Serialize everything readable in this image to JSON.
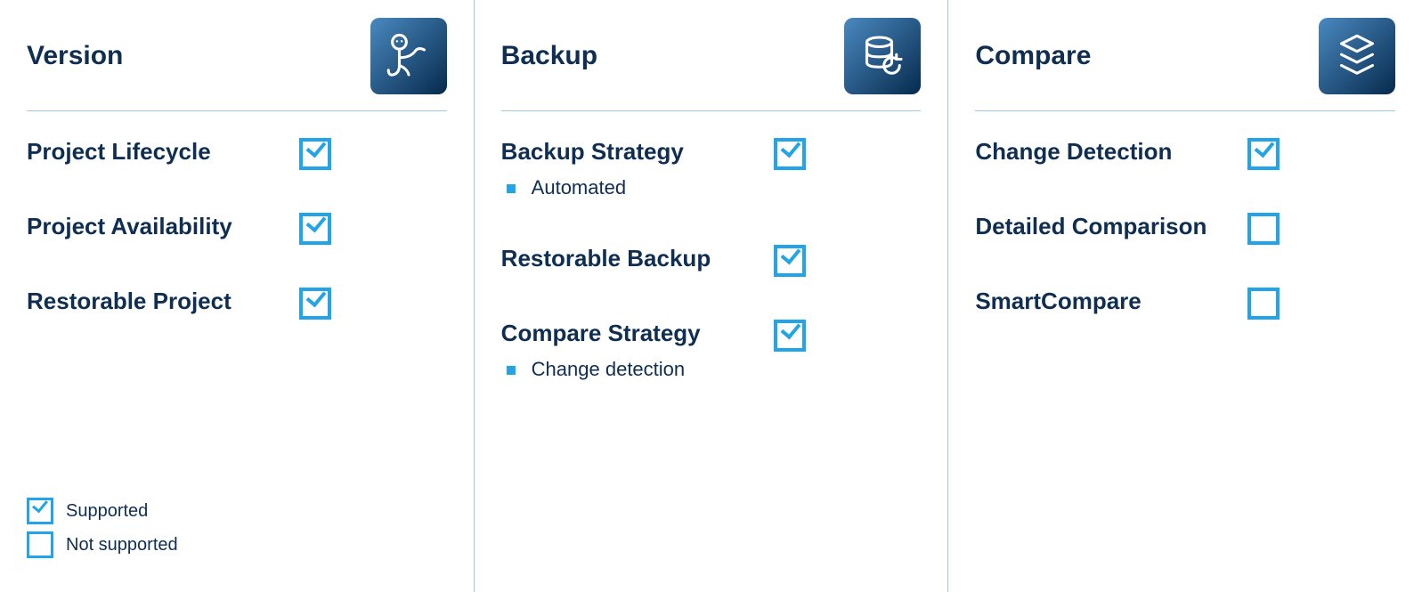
{
  "colors": {
    "heading": "#0f2e52",
    "accent": "#21a4e8",
    "tile_gradient_1": "#4a89c0",
    "tile_gradient_2": "#062a4d",
    "divider": "#9cc8e6"
  },
  "columns": [
    {
      "title": "Version",
      "icon": "version-icon",
      "features": [
        {
          "title": "Project Lifecycle",
          "supported": true,
          "bullets": []
        },
        {
          "title": "Project Availability",
          "supported": true,
          "bullets": []
        },
        {
          "title": "Restorable Project",
          "supported": true,
          "bullets": []
        }
      ]
    },
    {
      "title": "Backup",
      "icon": "backup-icon",
      "features": [
        {
          "title": "Backup Strategy",
          "supported": true,
          "bullets": [
            "Automated"
          ]
        },
        {
          "title": "Restorable Backup",
          "supported": true,
          "bullets": []
        },
        {
          "title": "Compare Strategy",
          "supported": true,
          "bullets": [
            "Change detection"
          ]
        }
      ]
    },
    {
      "title": "Compare",
      "icon": "compare-icon",
      "features": [
        {
          "title": "Change Detection",
          "supported": true,
          "bullets": []
        },
        {
          "title": "Detailed Comparison",
          "supported": false,
          "bullets": []
        },
        {
          "title": "SmartCompare",
          "supported": false,
          "bullets": []
        }
      ]
    }
  ],
  "legend": {
    "supported": "Supported",
    "not_supported": "Not supported"
  }
}
